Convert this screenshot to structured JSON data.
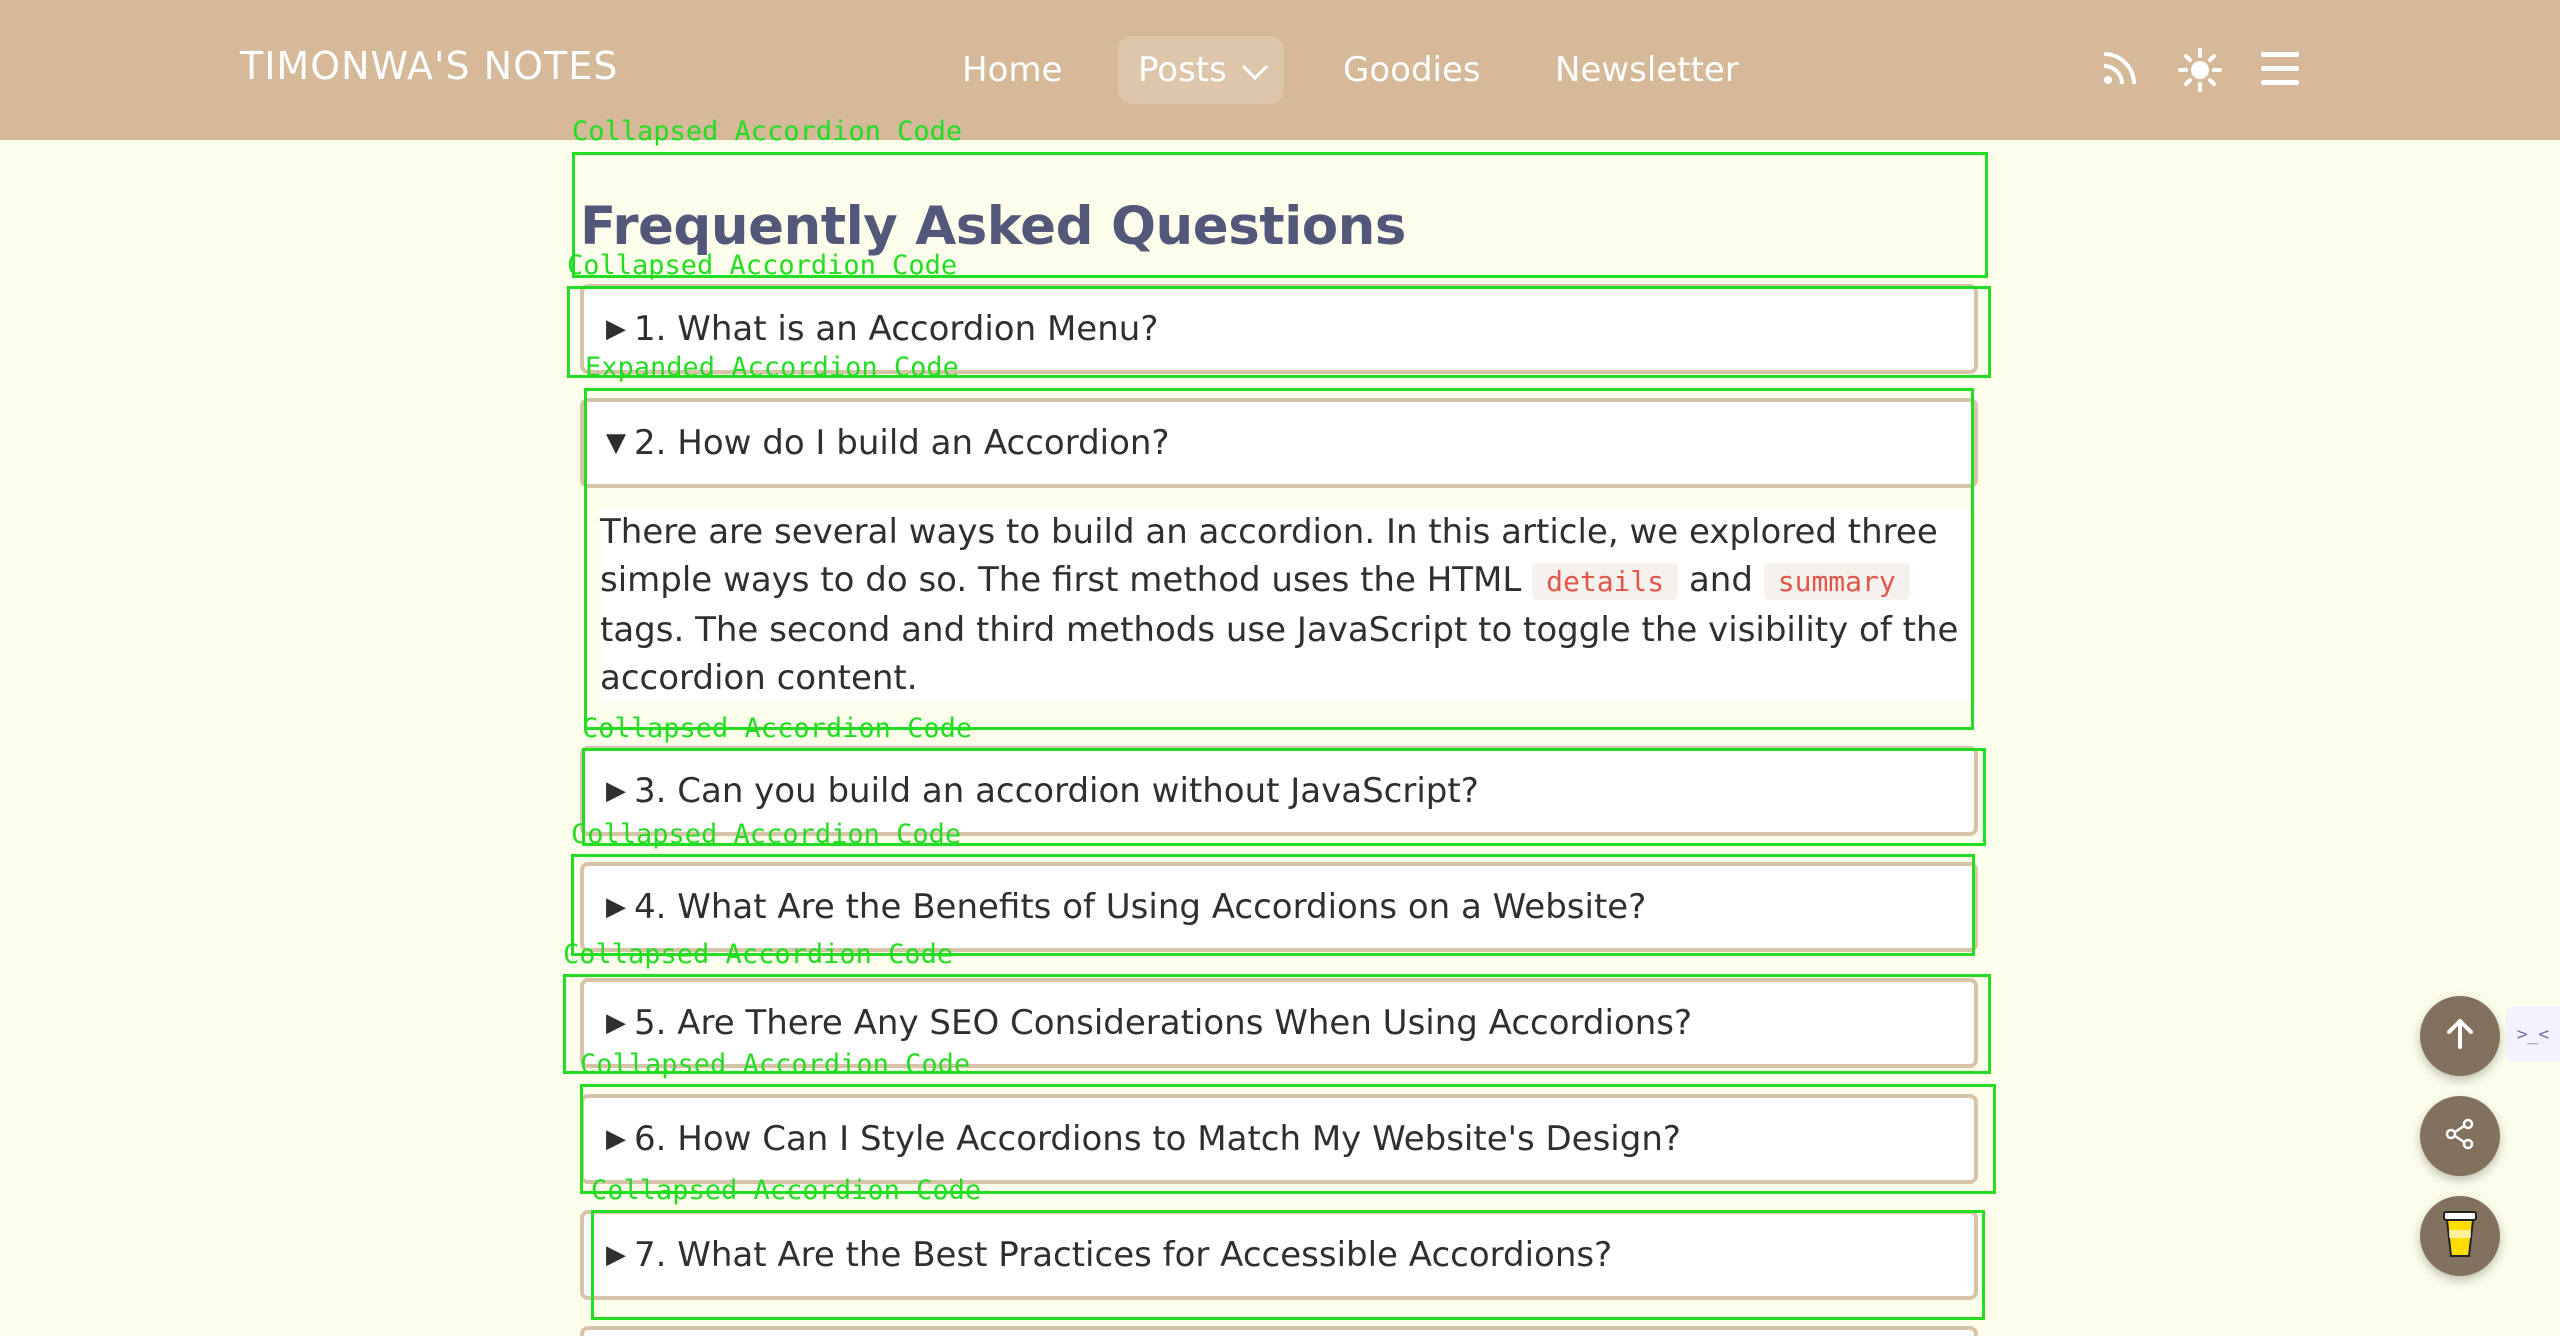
{
  "header": {
    "brand": "TIMONWA'S NOTES",
    "nav": {
      "home": "Home",
      "posts": "Posts",
      "goodies": "Goodies",
      "newsletter": "Newsletter"
    },
    "icons": [
      "rss-icon",
      "sun-icon",
      "menu-icon"
    ]
  },
  "faq": {
    "title": "Frequently Asked Questions",
    "items": [
      {
        "marker": "▶",
        "question": "1. What is an Accordion Menu?"
      },
      {
        "marker": "▼",
        "question": "2. How do I build an Accordion?"
      },
      {
        "marker": "▶",
        "question": "3. Can you build an accordion without JavaScript?"
      },
      {
        "marker": "▶",
        "question": "4. What Are the Benefits of Using Accordions on a Website?"
      },
      {
        "marker": "▶",
        "question": "5. Are There Any SEO Considerations When Using Accordions?"
      },
      {
        "marker": "▶",
        "question": "6. How Can I Style Accordions to Match My Website's Design?"
      },
      {
        "marker": "▶",
        "question": "7. What Are the Best Practices for Accessible Accordions?"
      }
    ],
    "answer2": {
      "part1": "There are several ways to build an accordion. In this article, we explored three simple ways to do so. The first method uses the HTML ",
      "code1": "details",
      "part2": " and ",
      "code2": "summary",
      "part3": " tags. The second and third methods use JavaScript to toggle the visibility of the accordion content."
    }
  },
  "annotations": {
    "collapsed": "Collapsed Accordion Code",
    "expanded": "Expanded Accordion Code"
  },
  "floating": {
    "side_tab": ">_<",
    "icons": [
      "arrow-up-icon",
      "share-icon",
      "coffee-cup-icon"
    ]
  },
  "colors": {
    "header_bg": "#d5b998",
    "page_bg": "#fdfdeb",
    "title": "#53577a",
    "accordion_border": "#d6c3a8",
    "code": "#e2564a",
    "annotation": "#22dd22",
    "fab_bg": "#82715d"
  }
}
